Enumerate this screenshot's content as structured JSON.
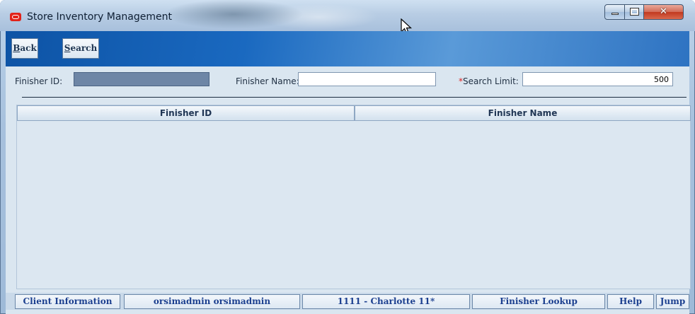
{
  "window": {
    "title": "Store Inventory Management"
  },
  "toolbar": {
    "back_label": "Back",
    "search_label": "Search"
  },
  "form": {
    "finisher_id": {
      "label": "Finisher ID:",
      "value": ""
    },
    "finisher_name": {
      "label": "Finisher Name:",
      "value": ""
    },
    "search_limit": {
      "required_mark": "*",
      "label": "Search Limit:",
      "value": "500"
    }
  },
  "table": {
    "columns": [
      "Finisher ID",
      "Finisher Name"
    ],
    "rows": []
  },
  "statusbar": {
    "client_info": "Client Information",
    "user": "orsimadmin orsimadmin",
    "store": "1111 - Charlotte 11*",
    "screen": "Finisher Lookup",
    "help": "Help",
    "jump": "Jump"
  },
  "icons": {
    "app": "oracle-app-icon",
    "minimize": "minimize-icon",
    "maximize": "maximize-icon",
    "close": "close-icon",
    "cursor": "mouse-pointer-icon"
  },
  "colors": {
    "toolbar_accent": "#1a69c0",
    "status_text": "#1b3f8f",
    "required_mark": "#d22222"
  }
}
